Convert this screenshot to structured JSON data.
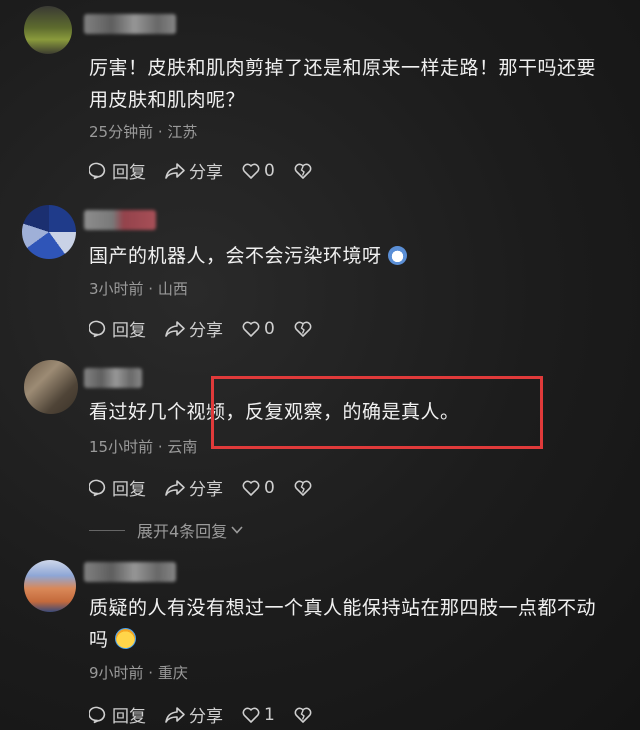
{
  "comments": [
    {
      "text_line1": "厉害！皮肤和肌肉剪掉了还是和原来一样走路！那干吗还要",
      "text_line2": "用皮肤和肌肉呢？",
      "meta": "25分钟前 · 江苏",
      "reply_label": "回复",
      "share_label": "分享",
      "like_count": "0"
    },
    {
      "text_line1": "国产的机器人，会不会污染环境呀",
      "meta": "3小时前 · 山西",
      "reply_label": "回复",
      "share_label": "分享",
      "like_count": "0",
      "emoji": "cat-face-emoji"
    },
    {
      "text_line1": "看过好几个视频，反复观察，的确是真人。",
      "meta": "15小时前 · 云南",
      "reply_label": "回复",
      "share_label": "分享",
      "like_count": "0",
      "expand_label": "展开4条回复"
    },
    {
      "text_line1": "质疑的人有没有想过一个真人能保持站在那四肢一点都不动",
      "text_line2": "吗",
      "meta": "9小时前 · 重庆",
      "reply_label": "回复",
      "share_label": "分享",
      "like_count": "1",
      "emoji": "crying-face-emoji"
    }
  ],
  "colors": {
    "highlight_box": "#e03a3a",
    "text": "#f0f0f0",
    "meta": "#9a9a9a"
  }
}
